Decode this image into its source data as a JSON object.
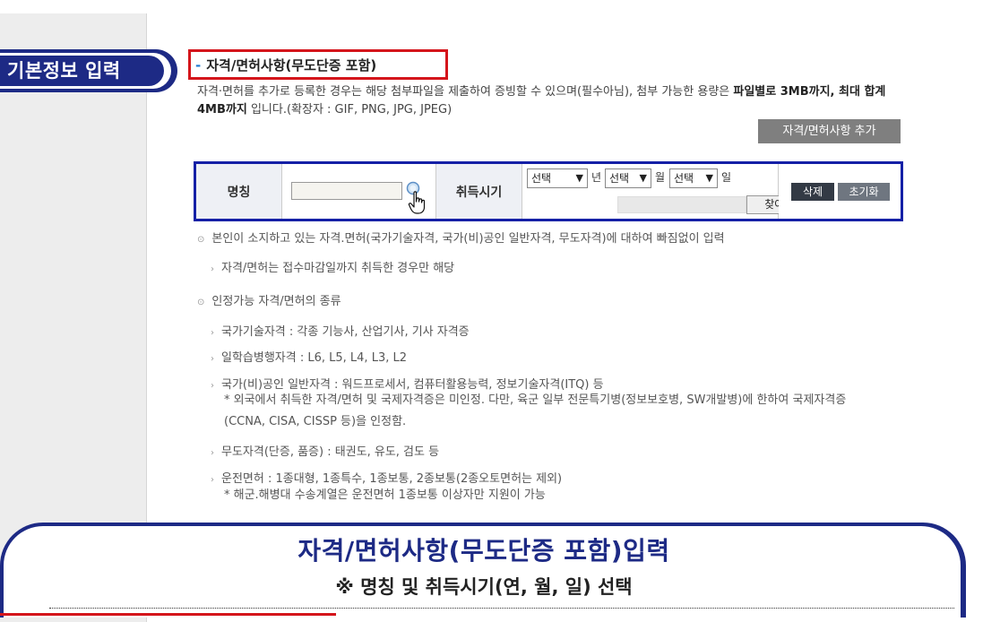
{
  "badge": {
    "label": "기본정보 입력"
  },
  "section": {
    "title": "자격/면허사항(무도단증 포함)",
    "desc_part1": "자격·면허를 추가로 등록한 경우는 해당 첨부파일을 제출하여 증빙할 수 있으며(필수아님), 첨부 가능한 용량은 ",
    "desc_bold1": "파일별로 3MB까지, 최대 합계 4MB까지",
    "desc_part2": " 입니다.(확장자 : GIF, PNG, JPG, JPEG)",
    "add_button": "자격/면허사항 추가"
  },
  "table": {
    "name_header": "명칭",
    "date_header": "취득시기",
    "year_select": "선택",
    "year_unit": "년",
    "month_select": "선택",
    "month_unit": "월",
    "day_select": "선택",
    "day_unit": "일",
    "browse_button": "찾아보기...",
    "delete_button": "삭제",
    "reset_button": "초기화"
  },
  "notes": {
    "bullet1": "본인이 소지하고 있는 자격.면허(국가기술자격, 국가(비)공인 일반자격, 무도자격)에 대하여 빠짐없이 입력",
    "sub1": "자격/면허는 접수마감일까지 취득한 경우만 해당",
    "bullet2": "인정가능 자격/면허의 종류",
    "sub2": "국가기술자격 : 각종 기능사, 산업기사, 기사 자격증",
    "sub3": "일학습병행자격 : L6, L5, L4, L3, L2",
    "sub4": "국가(비)공인 일반자격 : 워드프로세서, 컴퓨터활용능력, 정보기술자격(ITQ) 등",
    "note4a": "* 외국에서 취득한 자격/면허 및 국제자격증은 미인정. 다만, 육군 일부 전문특기병(정보보호병, SW개발병)에 한하여 국제자격증",
    "note4b": "(CCNA, CISA, CISSP 등)을 인정함.",
    "sub5": "무도자격(단증, 품증) : 태권도, 유도, 검도 등",
    "sub6": "운전면허 : 1종대형, 1종특수, 1종보통, 2종보통(2종오토면허는 제외)",
    "note6": "* 해군.해병대 수송계열은 운전면허 1종보통 이상자만 지원이 가능"
  },
  "banner": {
    "title": "자격/면허사항(무도단증 포함)입력",
    "subtitle": "※ 명칭 및 취득시기(연, 월, 일) 선택"
  },
  "colors": {
    "navy": "#1d2a85",
    "red": "#d4151b",
    "table_border": "#1520a6"
  }
}
